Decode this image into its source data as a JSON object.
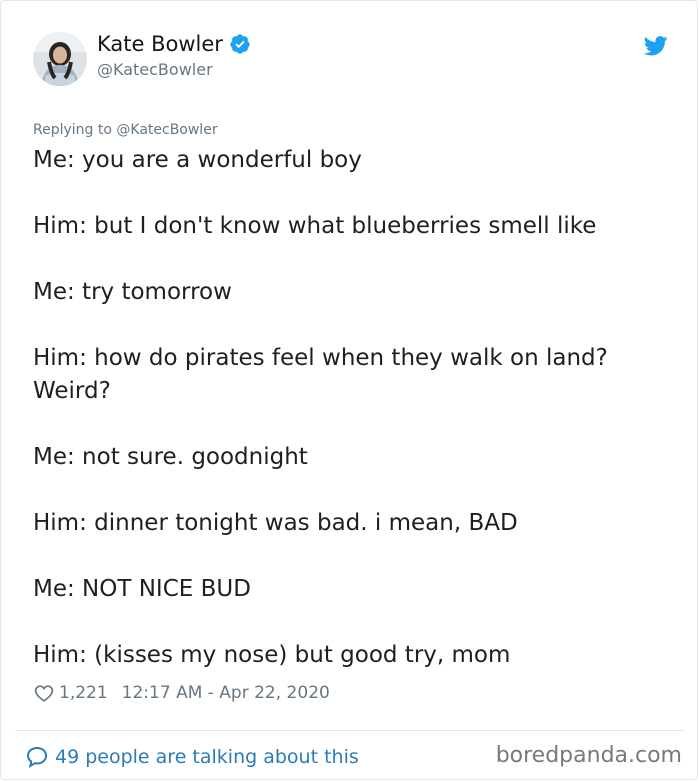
{
  "author": {
    "display_name": "Kate Bowler",
    "handle": "@KatecBowler",
    "verified": true
  },
  "tweet": {
    "replying_to": "Replying to @KatecBowler",
    "lines": [
      "Me: you are a wonderful boy",
      "Him: but I don't know what blueberries smell like",
      "Me: try tomorrow",
      "Him: how do pirates feel when they walk on land? Weird?",
      "Me: not sure. goodnight",
      "Him: dinner tonight was bad. i mean, BAD",
      "Me: NOT NICE BUD",
      "Him: (kisses my nose) but good try, mom"
    ],
    "likes": "1,221",
    "timestamp": "12:17 AM - Apr 22, 2020"
  },
  "footer": {
    "conversation_link": "49 people are talking about this"
  },
  "watermark": "boredpanda.com",
  "colors": {
    "twitter_blue": "#1da1f2",
    "link_blue": "#2b7bb9",
    "secondary_text": "#657786",
    "primary_text": "#1c2022",
    "border": "#e1e8ed"
  },
  "icons": {
    "verified": "verified-badge-icon",
    "bird": "twitter-bird-icon",
    "like": "heart-outline-icon",
    "reply": "speech-bubble-icon"
  }
}
